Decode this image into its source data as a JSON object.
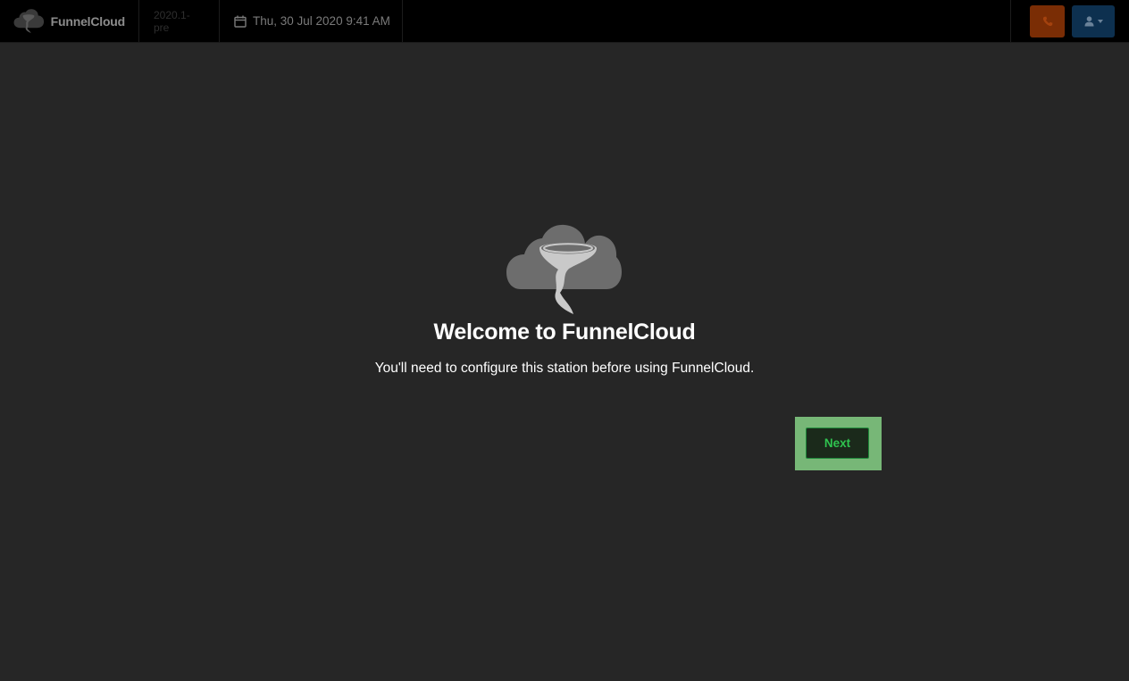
{
  "app": {
    "name": "FunnelCloud",
    "version": "2020.1-pre",
    "datetime": "Thu, 30 Jul 2020 9:41 AM"
  },
  "header": {
    "phone_icon": "phone-icon",
    "user_icon": "user-icon",
    "phone_button_color": "#7a2d05",
    "user_button_color": "#0d304f"
  },
  "welcome": {
    "title": "Welcome to FunnelCloud",
    "message": "You'll need to configure this station before using FunnelCloud.",
    "next_label": "Next",
    "next_color": "#2fc44f",
    "highlight_color": "#77b777"
  }
}
